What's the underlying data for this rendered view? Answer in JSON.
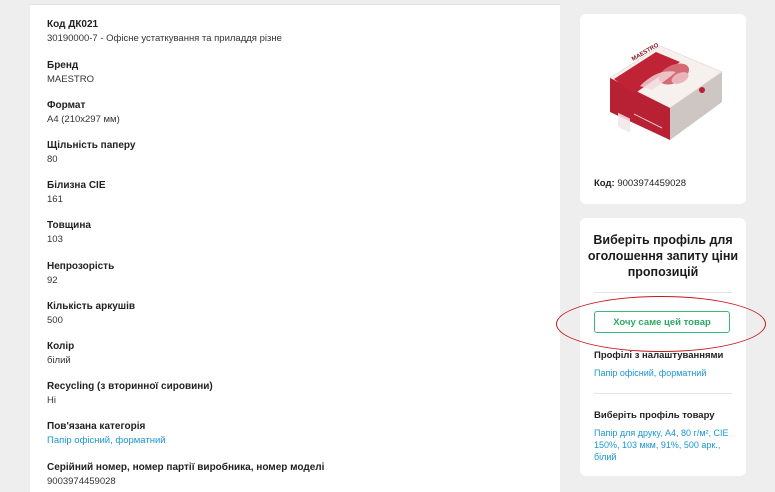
{
  "attributes": [
    {
      "label": "Код ДК021",
      "value": "30190000-7 - Офісне устаткування та приладдя різне",
      "is_link": false
    },
    {
      "label": "Бренд",
      "value": "MAESTRO",
      "is_link": false
    },
    {
      "label": "Формат",
      "value": "А4 (210х297 мм)",
      "is_link": false
    },
    {
      "label": "Щільність паперу",
      "value": "80",
      "is_link": false
    },
    {
      "label": "Білизна CIE",
      "value": "161",
      "is_link": false
    },
    {
      "label": "Товщина",
      "value": "103",
      "is_link": false
    },
    {
      "label": "Непрозорість",
      "value": "92",
      "is_link": false
    },
    {
      "label": "Кількість аркушів",
      "value": "500",
      "is_link": false
    },
    {
      "label": "Колір",
      "value": "білий",
      "is_link": false
    },
    {
      "label": "Recycling (з вторинної сировини)",
      "value": "Ні",
      "is_link": false
    },
    {
      "label": "Пов'язана категорія",
      "value": "Папір офісний, форматний",
      "is_link": true
    },
    {
      "label": "Серійний номер, номер партії виробника, номер моделі",
      "value": "9003974459028",
      "is_link": false
    }
  ],
  "product": {
    "code_label": "Код:",
    "code_value": "9003974459028",
    "image_icon": "paper-ream-box-image",
    "box_brand": "MAESTRO"
  },
  "profile": {
    "title": "Виберіть профіль для оголошення запиту ціни пропозицій",
    "want_button": "Хочу саме цей товар",
    "configured_label": "Профілі з налаштуваннями",
    "configured_link": "Папір офісний, форматний",
    "select_product_label": "Виберіть профіль товару",
    "product_profile_link": "Папір для друку, А4, 80 г/м², CIE 150%, 103 мкм, 91%, 500 арк., білий"
  },
  "colors": {
    "accent_green": "#3cb878",
    "link_blue": "#1a96d4",
    "highlight_red": "#c8171e"
  }
}
